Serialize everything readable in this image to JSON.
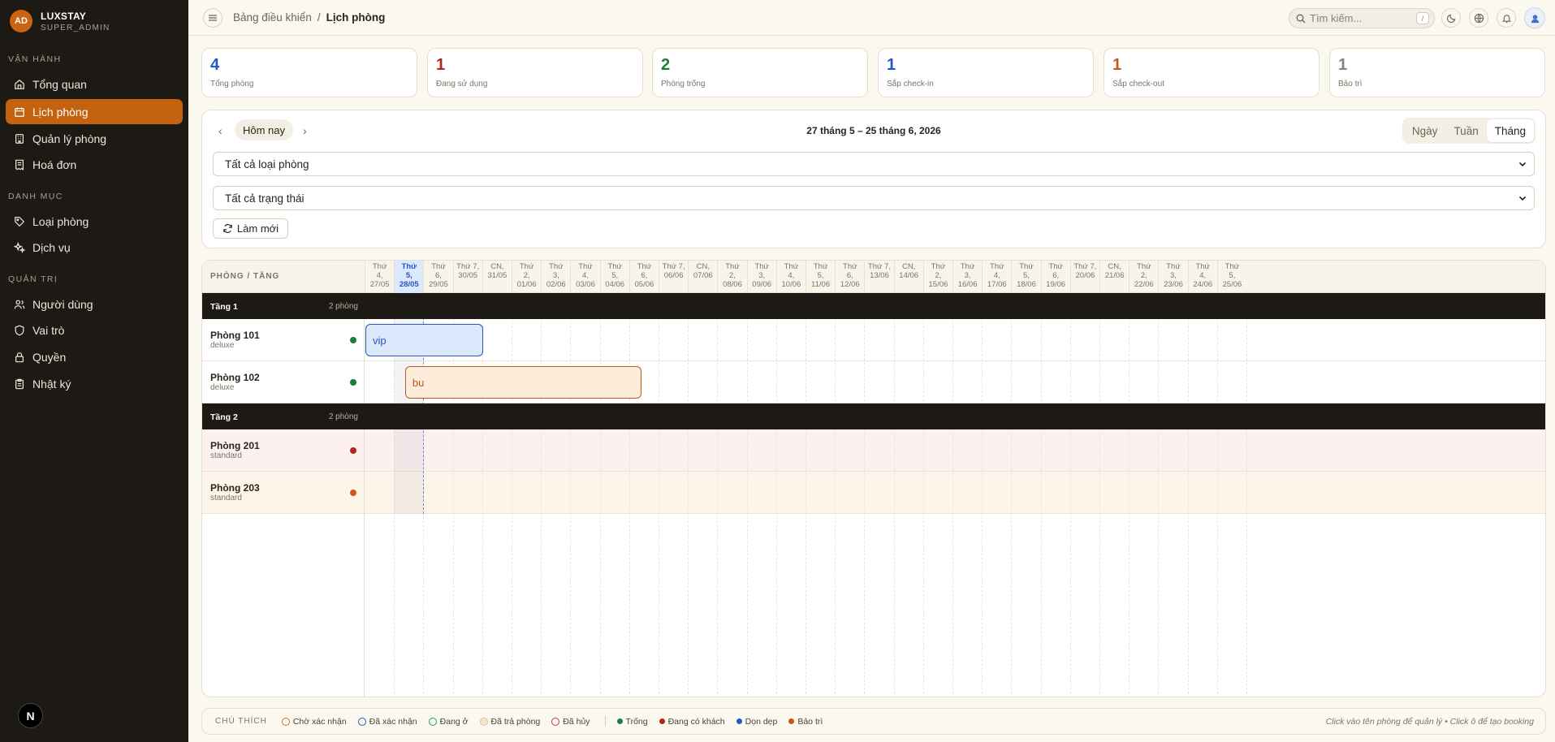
{
  "brand": {
    "initials": "AD",
    "name": "LUXSTAY",
    "role": "SUPER_ADMIN"
  },
  "sidebar": {
    "sections": [
      {
        "title": "VẬN HÀNH",
        "items": [
          "Tổng quan",
          "Lịch phòng",
          "Quản lý phòng",
          "Hoá đơn"
        ]
      },
      {
        "title": "DANH MỤC",
        "items": [
          "Loại phòng",
          "Dịch vụ"
        ]
      },
      {
        "title": "QUẢN TRỊ",
        "items": [
          "Người dùng",
          "Vai trò",
          "Quyền",
          "Nhật ký"
        ]
      }
    ],
    "active": "Lịch phòng",
    "footer_badge": "N"
  },
  "header": {
    "breadcrumb": [
      "Bảng điều khiển",
      "Lịch phòng"
    ],
    "separator": "/",
    "search_placeholder": "Tìm kiếm...",
    "search_shortcut": "/"
  },
  "stats": [
    {
      "value": "4",
      "label": "Tổng phòng",
      "color": "#2456c6"
    },
    {
      "value": "1",
      "label": "Đang sử dụng",
      "color": "#b3261e"
    },
    {
      "value": "2",
      "label": "Phòng trống",
      "color": "#1f7a3d"
    },
    {
      "value": "1",
      "label": "Sắp check-in",
      "color": "#2456c6"
    },
    {
      "value": "1",
      "label": "Sắp check-out",
      "color": "#c0581a"
    },
    {
      "value": "1",
      "label": "Bảo trì",
      "color": "#8a8172"
    }
  ],
  "controls": {
    "prev": "‹",
    "next": "›",
    "today": "Hôm nay",
    "range": "27 tháng 5 – 25 tháng 6, 2026",
    "views": [
      "Ngày",
      "Tuần",
      "Tháng"
    ],
    "active_view": "Tháng",
    "room_type_filter": "Tất cả loại phòng",
    "status_filter": "Tất cả trạng thái",
    "refresh": "Làm mới"
  },
  "calendar": {
    "room_column_header": "PHÒNG / TẦNG",
    "today_index": 1,
    "days": [
      [
        "Thứ",
        "4,",
        "27/05"
      ],
      [
        "Thứ",
        "5,",
        "28/05"
      ],
      [
        "Thứ",
        "6,",
        "29/05"
      ],
      [
        "Thứ 7,",
        "30/05",
        ""
      ],
      [
        "CN,",
        "31/05",
        ""
      ],
      [
        "Thứ",
        "2,",
        "01/06"
      ],
      [
        "Thứ",
        "3,",
        "02/06"
      ],
      [
        "Thứ",
        "4,",
        "03/06"
      ],
      [
        "Thứ",
        "5,",
        "04/06"
      ],
      [
        "Thứ",
        "6,",
        "05/06"
      ],
      [
        "Thứ 7,",
        "06/06",
        ""
      ],
      [
        "CN,",
        "07/06",
        ""
      ],
      [
        "Thứ",
        "2,",
        "08/06"
      ],
      [
        "Thứ",
        "3,",
        "09/06"
      ],
      [
        "Thứ",
        "4,",
        "10/06"
      ],
      [
        "Thứ",
        "5,",
        "11/06"
      ],
      [
        "Thứ",
        "6,",
        "12/06"
      ],
      [
        "Thứ 7,",
        "13/06",
        ""
      ],
      [
        "CN,",
        "14/06",
        ""
      ],
      [
        "Thứ",
        "2,",
        "15/06"
      ],
      [
        "Thứ",
        "3,",
        "16/06"
      ],
      [
        "Thứ",
        "4,",
        "17/06"
      ],
      [
        "Thứ",
        "5,",
        "18/06"
      ],
      [
        "Thứ",
        "6,",
        "19/06"
      ],
      [
        "Thứ 7,",
        "20/06",
        ""
      ],
      [
        "CN,",
        "21/06",
        ""
      ],
      [
        "Thứ",
        "2,",
        "22/06"
      ],
      [
        "Thứ",
        "3,",
        "23/06"
      ],
      [
        "Thứ",
        "4,",
        "24/06"
      ],
      [
        "Thứ",
        "5,",
        "25/06"
      ]
    ],
    "floors": [
      {
        "name": "Tầng 1",
        "count": "2 phòng",
        "rooms": [
          {
            "name": "Phòng 101",
            "type": "deluxe",
            "status_color": "#1f7a3d",
            "row_bg": "#ffffff"
          },
          {
            "name": "Phòng 102",
            "type": "deluxe",
            "status_color": "#1f7a3d",
            "row_bg": "#ffffff"
          }
        ]
      },
      {
        "name": "Tầng 2",
        "count": "2 phòng",
        "rooms": [
          {
            "name": "Phòng 201",
            "type": "standard",
            "status_color": "#b3261e",
            "row_bg": "#fdf1ef"
          },
          {
            "name": "Phòng 203",
            "type": "standard",
            "status_color": "#d4541a",
            "row_bg": "#fdf5ea"
          }
        ]
      }
    ],
    "bookings": [
      {
        "label": "vip",
        "room": "Phòng 101",
        "start_day": 0,
        "span_days": 4.05,
        "bg": "#dce8fb",
        "border": "#2456c6",
        "color": "#2456c6"
      },
      {
        "label": "bu",
        "room": "Phòng 102",
        "start_day": 1.35,
        "span_days": 8.1,
        "bg": "#fdecd9",
        "border": "#c0581a",
        "color": "#c0581a"
      }
    ]
  },
  "legend": {
    "title": "CHÚ THÍCH",
    "booking_states": [
      {
        "label": "Chờ xác nhận",
        "color": "#c97a1e"
      },
      {
        "label": "Đã xác nhận",
        "color": "#2456c6"
      },
      {
        "label": "Đang ở",
        "color": "#1f9a56"
      },
      {
        "label": "Đã trả phòng",
        "color": "#d8c4a0"
      },
      {
        "label": "Đã hủy",
        "color": "#d2334a"
      }
    ],
    "room_states": [
      {
        "label": "Trống",
        "color": "#1f7a3d"
      },
      {
        "label": "Đang có khách",
        "color": "#b3261e"
      },
      {
        "label": "Dọn dẹp",
        "color": "#2456c6"
      },
      {
        "label": "Bảo trì",
        "color": "#c0581a"
      }
    ],
    "hint": "Click vào tên phòng để quản lý • Click ô để tạo booking"
  }
}
